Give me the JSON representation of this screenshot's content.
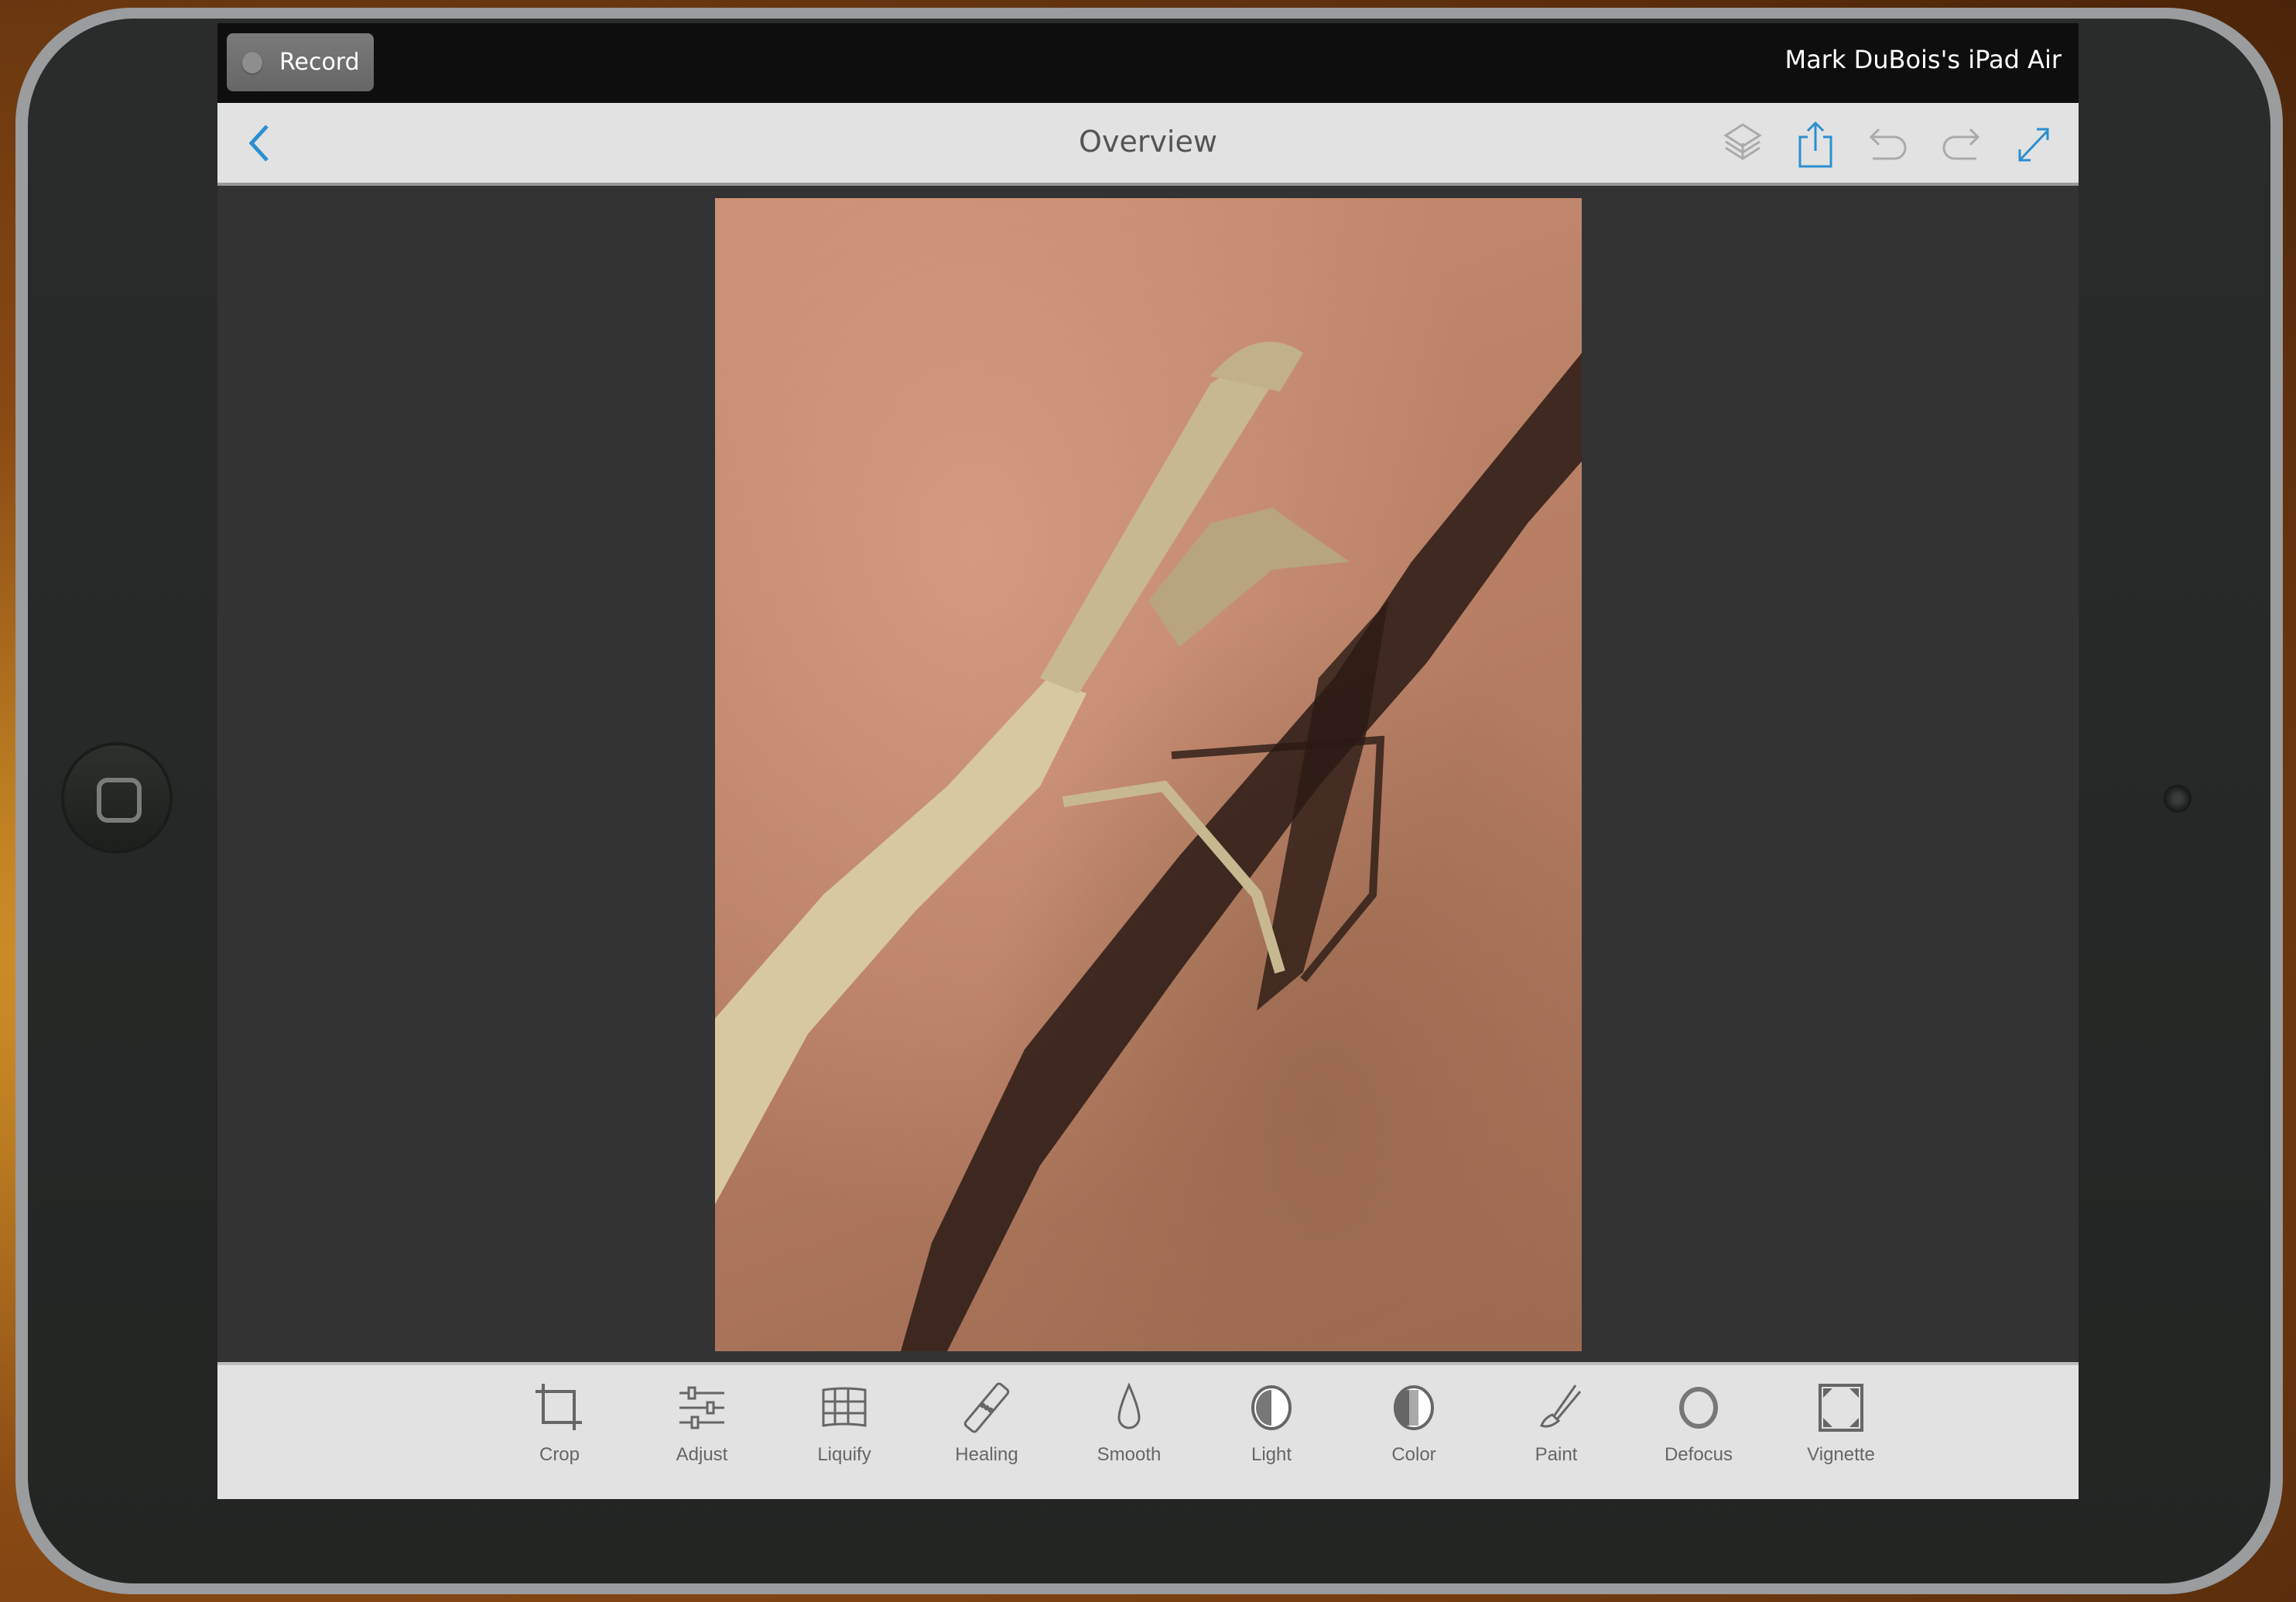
{
  "status_bar": {
    "record_label": "Record",
    "device_name": "Mark DuBois's iPad Air"
  },
  "nav_bar": {
    "title": "Overview",
    "back_icon": "chevron-left-icon",
    "actions": [
      {
        "name": "layers",
        "icon": "layers-icon"
      },
      {
        "name": "share",
        "icon": "share-icon"
      },
      {
        "name": "undo",
        "icon": "undo-icon"
      },
      {
        "name": "redo",
        "icon": "redo-icon"
      },
      {
        "name": "fullscreen",
        "icon": "expand-icon"
      }
    ],
    "accent_color": "#2a8fd0"
  },
  "canvas": {
    "image_description": "Praying mantis on reddish concrete with shadow"
  },
  "toolbar": {
    "tools": [
      {
        "label": "Crop",
        "icon": "crop-icon"
      },
      {
        "label": "Adjust",
        "icon": "sliders-icon"
      },
      {
        "label": "Liquify",
        "icon": "grid-warp-icon"
      },
      {
        "label": "Healing",
        "icon": "bandage-icon"
      },
      {
        "label": "Smooth",
        "icon": "droplet-icon"
      },
      {
        "label": "Light",
        "icon": "half-circle-icon"
      },
      {
        "label": "Color",
        "icon": "color-circle-icon"
      },
      {
        "label": "Paint",
        "icon": "brush-icon"
      },
      {
        "label": "Defocus",
        "icon": "circle-icon"
      },
      {
        "label": "Vignette",
        "icon": "vignette-icon"
      }
    ]
  }
}
